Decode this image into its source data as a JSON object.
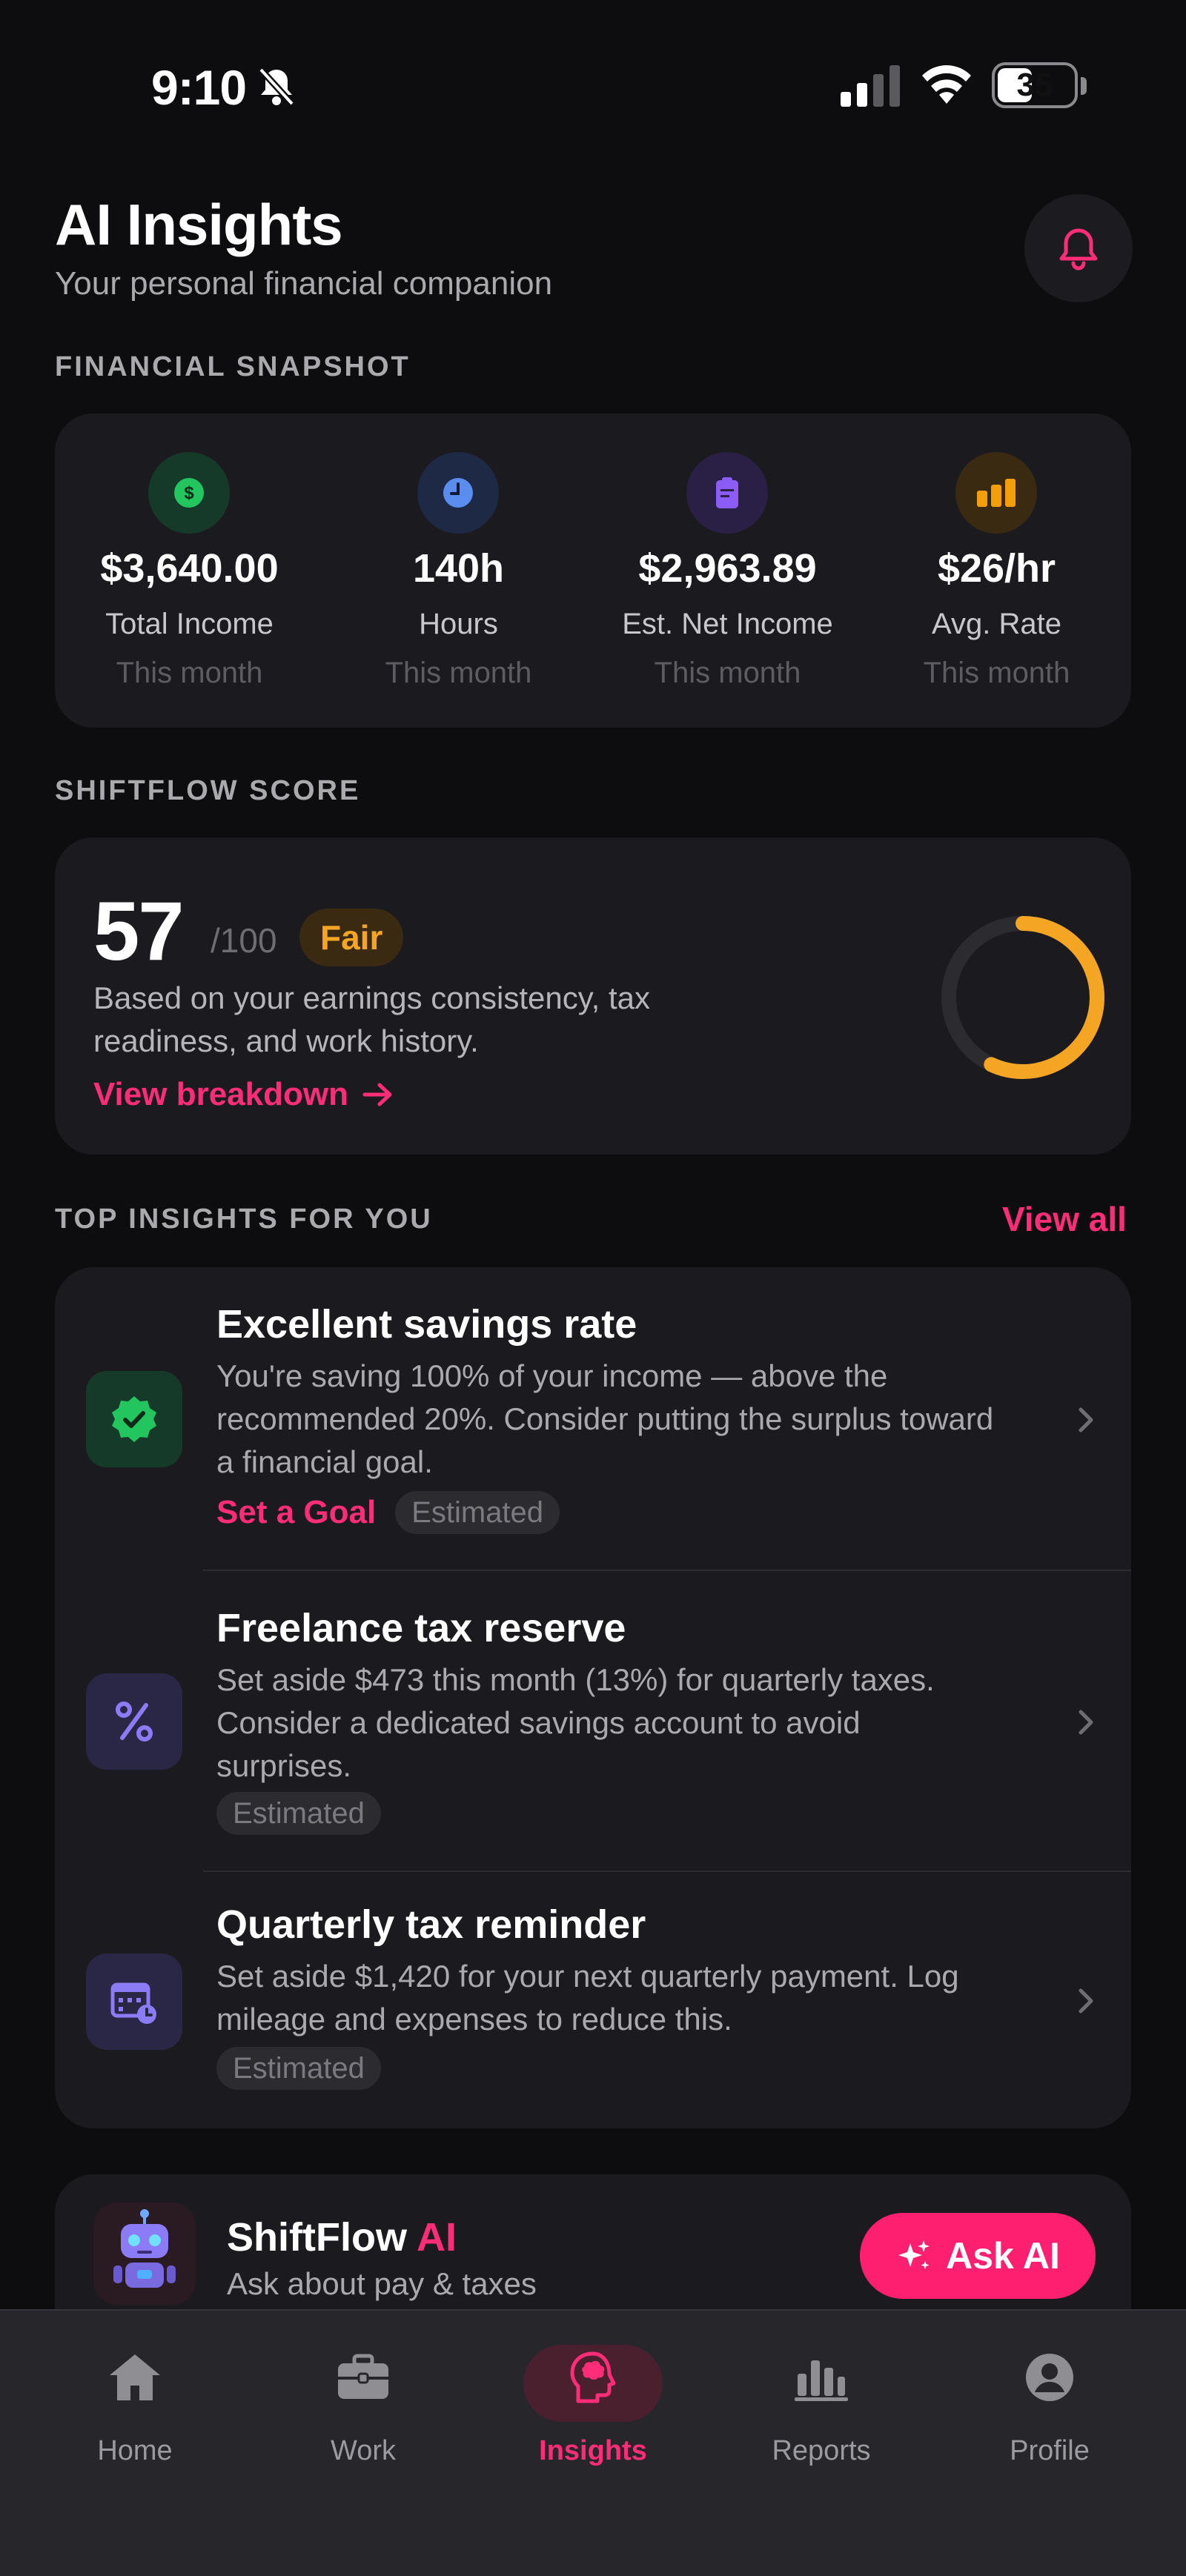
{
  "status_bar": {
    "time": "9:10",
    "battery": "35"
  },
  "header": {
    "title": "AI Insights",
    "subtitle": "Your personal financial companion"
  },
  "snapshot": {
    "section_label": "FINANCIAL SNAPSHOT",
    "items": [
      {
        "icon": "dollar-icon",
        "value": "$3,640.00",
        "label": "Total Income",
        "period": "This month",
        "color": "#22c55e"
      },
      {
        "icon": "clock-icon",
        "value": "140h",
        "label": "Hours",
        "period": "This month",
        "color": "#5b8def"
      },
      {
        "icon": "clipboard-icon",
        "value": "$2,963.89",
        "label": "Est. Net Income",
        "period": "This month",
        "color": "#8b5cf6"
      },
      {
        "icon": "bar-chart-icon",
        "value": "$26/hr",
        "label": "Avg. Rate",
        "period": "This month",
        "color": "#f59e0b"
      }
    ]
  },
  "score": {
    "section_label": "SHIFTFLOW SCORE",
    "value": "57",
    "max": "/100",
    "progress": 0.57,
    "rating": "Fair",
    "description": "Based on your earnings consistency, tax readiness, and work history.",
    "link": "View breakdown",
    "color": "#f5a524"
  },
  "insights": {
    "section_label": "TOP INSIGHTS FOR YOU",
    "view_all": "View all",
    "items": [
      {
        "icon": "verified-badge-icon",
        "title": "Excellent savings rate",
        "text": "You're saving 100% of your income — above the recommended 20%. Consider putting the surplus toward a financial goal.",
        "action": "Set a Goal",
        "tag": "Estimated"
      },
      {
        "icon": "percent-icon",
        "title": "Freelance tax reserve",
        "text": "Set aside $473 this month (13%) for quarterly taxes. Consider a dedicated savings account to avoid surprises.",
        "tag": "Estimated"
      },
      {
        "icon": "calendar-clock-icon",
        "title": "Quarterly tax reminder",
        "text": "Set aside $1,420 for your next quarterly payment. Log mileage and expenses to reduce this.",
        "tag": "Estimated"
      }
    ]
  },
  "ai_banner": {
    "title": "ShiftFlow",
    "title_accent": "AI",
    "subtitle": "Ask about pay & taxes",
    "button": "Ask AI"
  },
  "tabs": [
    {
      "label": "Home",
      "icon": "home-icon"
    },
    {
      "label": "Work",
      "icon": "briefcase-icon"
    },
    {
      "label": "Insights",
      "icon": "brain-icon",
      "active": true
    },
    {
      "label": "Reports",
      "icon": "bar-chart-icon"
    },
    {
      "label": "Profile",
      "icon": "profile-icon"
    }
  ],
  "accent_color": "#ff2d78"
}
